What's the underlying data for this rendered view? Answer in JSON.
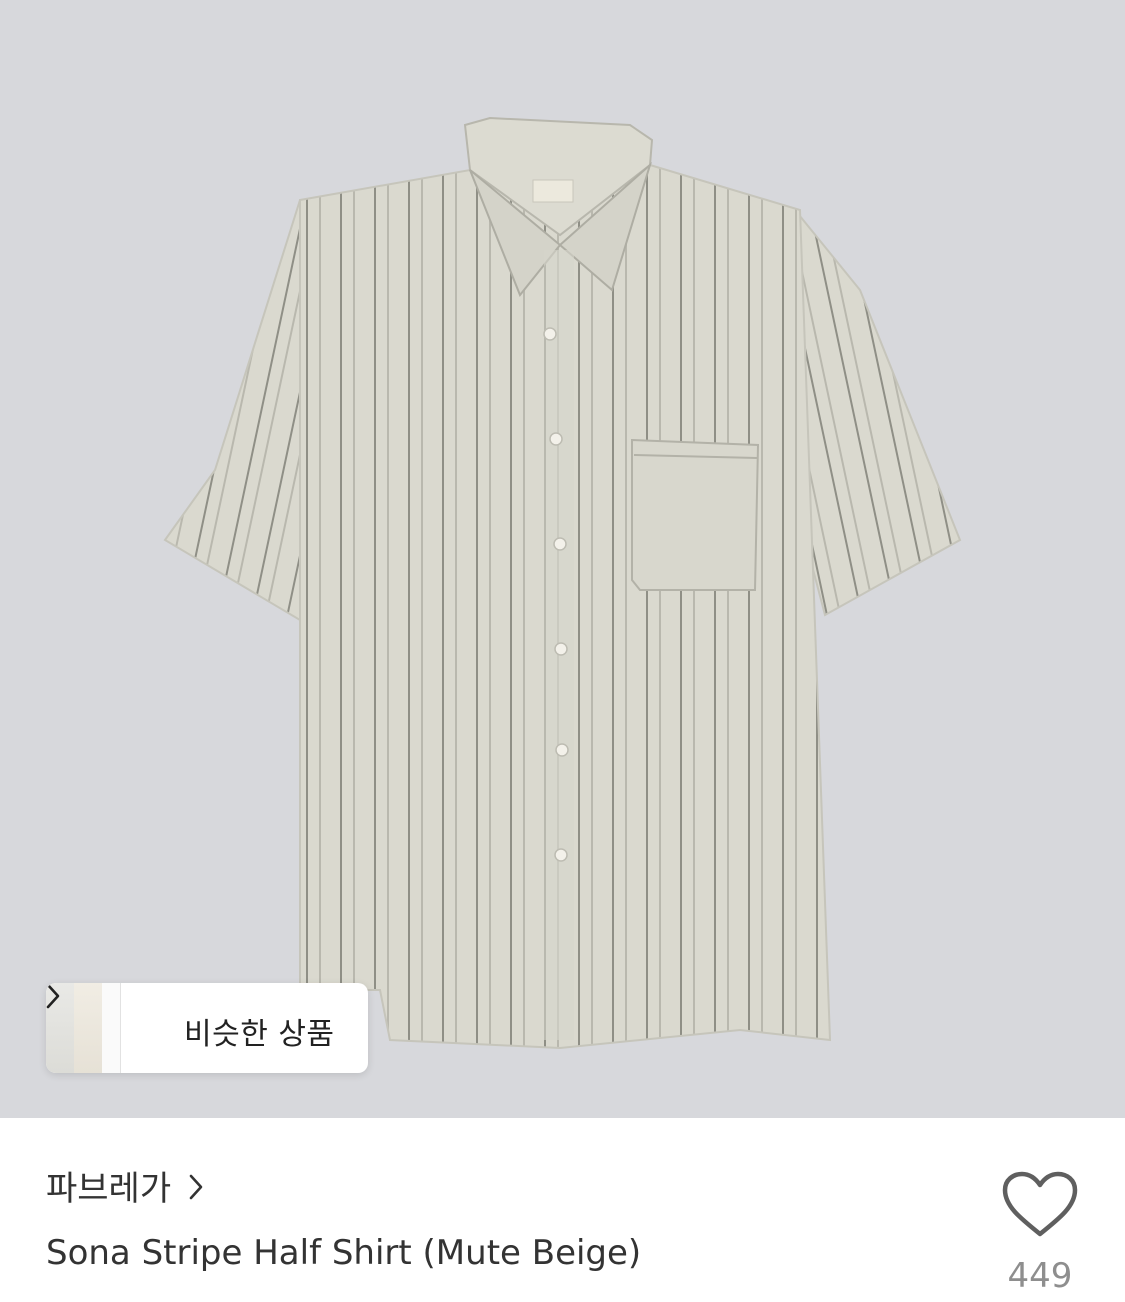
{
  "product_image": {
    "alt": "Sona Stripe Half Shirt (Mute Beige)",
    "colors": {
      "background": "#d7d8dc",
      "fabric": "#d9d8ce",
      "stripe": "#8f8f86"
    }
  },
  "similar_products": {
    "label": "비슷한 상품",
    "icon": "chevron-right-icon"
  },
  "brand": {
    "name": "파브레가",
    "icon": "chevron-right-icon"
  },
  "product": {
    "title": "Sona Stripe Half Shirt (Mute Beige)"
  },
  "like": {
    "icon": "heart-outline-icon",
    "count": "449"
  }
}
